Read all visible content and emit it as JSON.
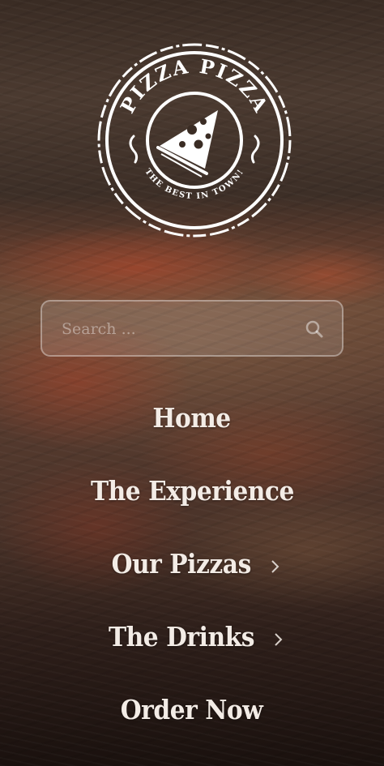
{
  "logo": {
    "title": "PIZZA PIZZA",
    "tagline": "THE BEST IN TOWN!",
    "icon": "pizza-slice-icon"
  },
  "search": {
    "placeholder": "Search ...",
    "icon": "search-icon"
  },
  "nav": {
    "items": [
      {
        "label": "Home"
      },
      {
        "label": "The Experience"
      },
      {
        "label": "Our Pizzas",
        "icon": "chevron-right-icon"
      },
      {
        "label": "The Drinks",
        "icon": "chevron-right-icon"
      },
      {
        "label": "Order Now"
      }
    ]
  },
  "colors": {
    "text": "#f3ece6",
    "logo": "#ffffff",
    "search_border": "#ffffff"
  }
}
